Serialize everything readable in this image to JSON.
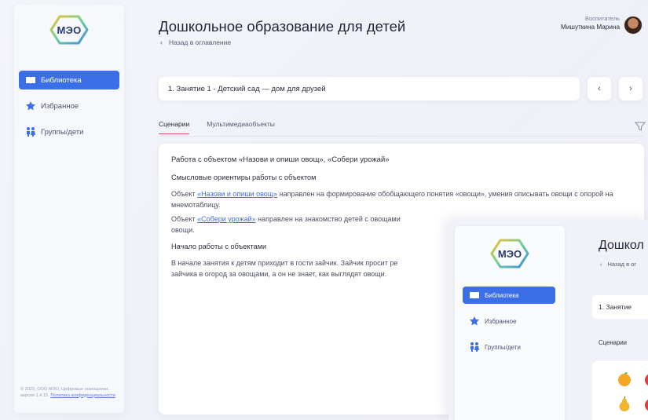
{
  "sidebar": {
    "logo_text": "МЭО",
    "items": [
      {
        "label": "Библиотека",
        "icon": "book-icon",
        "active": true
      },
      {
        "label": "Избранное",
        "icon": "star-icon",
        "active": false
      },
      {
        "label": "Группы/дети",
        "icon": "children-icon",
        "active": false
      }
    ],
    "footer_text": "© 2022, ООО МЭО, Цифровые помощники, версия 1.4.15.",
    "footer_link": "Политика конфиденциальности"
  },
  "header": {
    "title": "Дошкольное образование для детей",
    "back_label": "Назад в оглавление",
    "user_role": "Воспитатель",
    "user_name": "Мишуткина Марина"
  },
  "lesson": {
    "current": "1. Занятие 1 - Детский сад — дом для друзей",
    "prev_icon": "chevron-left-icon",
    "next_icon": "chevron-right-icon"
  },
  "tabs": [
    {
      "label": "Сценарии",
      "active": true
    },
    {
      "label": "Мультимедиаобъекты",
      "active": false
    }
  ],
  "content": {
    "heading": "Работа с объектом «Назови и опиши овощ», «Собери урожай»",
    "section1_title": "Смысловые ориентиры работы с объектом",
    "p1_prefix": "Объект ",
    "p1_link": "«Назови и опиши овощ»",
    "p1_suffix": " направлен на формирование обобщающего понятия «овощи», умения описывать овощи с опорой на мнемотаблицу.",
    "p2_prefix": "Объект ",
    "p2_link": "«Собери урожай»",
    "p2_suffix": " направлен на знакомство детей с овощами",
    "p2_cont": "овощи.",
    "section2_title": "Начало работы с объектами",
    "p3_line1": "В начале занятия к детям приходит в гости зайчик. Зайчик просит ре",
    "p3_line2": "зайчика в огород за овощами, а он не знает, как выглядят овощи."
  },
  "overlay": {
    "logo_text": "МЭО",
    "title": "Дошкол",
    "back_label": "Назад в ог",
    "lesson": "1. Занятие",
    "tab": "Сценарии",
    "items": [
      {
        "label": "Библиотека"
      },
      {
        "label": "Избранное"
      },
      {
        "label": "Группы/дети"
      }
    ]
  },
  "colors": {
    "accent": "#3c6ee8",
    "tab_underline": "#d94c6a",
    "link": "#3c6ee8"
  }
}
